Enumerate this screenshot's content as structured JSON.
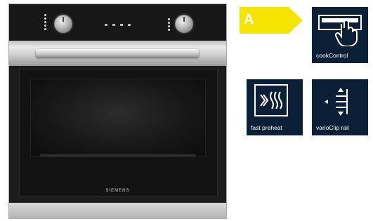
{
  "energy_class": {
    "label": "A",
    "color": "#f4e400"
  },
  "oven": {
    "brand": "SIEMENS",
    "display_text": "",
    "colors": {
      "body": "#1c1c1c",
      "steel": "#c8c8c8"
    }
  },
  "features": [
    {
      "label": "cookControl",
      "icon": "hand-touch-panel-icon"
    },
    {
      "label": "fast preheat",
      "icon": "heat-waves-icon"
    },
    {
      "label": "varioClip rail",
      "icon": "rail-arrows-icon"
    }
  ],
  "colors": {
    "feature_bg": "#0b1f36"
  }
}
